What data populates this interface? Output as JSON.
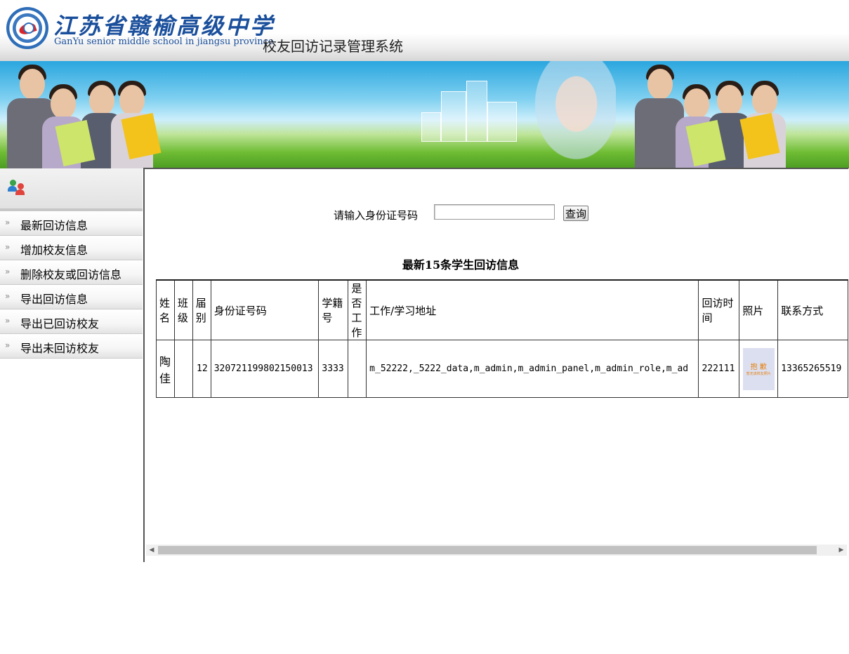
{
  "header": {
    "school_name_cn": "江苏省赣榆高级中学",
    "school_name_en": "GanYu senior middle school in jiangsu province",
    "system_title": "校友回访记录管理系统"
  },
  "sidebar": {
    "head_icon": "users-icon",
    "items": [
      {
        "label": "最新回访信息",
        "icon": "chevron-double-right-icon"
      },
      {
        "label": "增加校友信息",
        "icon": "chevron-double-right-icon"
      },
      {
        "label": "删除校友或回访信息",
        "icon": "chevron-double-right-icon"
      },
      {
        "label": "导出回访信息",
        "icon": "chevron-double-right-icon"
      },
      {
        "label": "导出已回访校友",
        "icon": "chevron-double-right-icon"
      },
      {
        "label": "导出未回访校友",
        "icon": "chevron-double-right-icon"
      }
    ]
  },
  "search": {
    "label": "请输入身份证号码",
    "value": "",
    "button_label": "查询"
  },
  "table": {
    "caption": "最新15条学生回访信息",
    "columns": [
      "姓名",
      "班级",
      "届别",
      "身份证号码",
      "学籍号",
      "是否工作",
      "工作/学习地址",
      "回访时间",
      "照片",
      "联系方式"
    ],
    "rows": [
      {
        "name": "陶佳",
        "class": "",
        "session": "12",
        "id_number": "320721199802150013",
        "student_no": "3333",
        "working": "",
        "address": "m_52222,_5222_data,m_admin,m_admin_panel,m_admin_role,m_ad",
        "visit_time": "222111",
        "photo_text_main": "抱 歉",
        "photo_text_sub": "暂无该校友照片",
        "contact": "13365265519"
      }
    ]
  },
  "colors": {
    "brand_blue": "#1a4f9c",
    "photo_placeholder": "#dcdff0",
    "photo_text": "#e5820f"
  }
}
